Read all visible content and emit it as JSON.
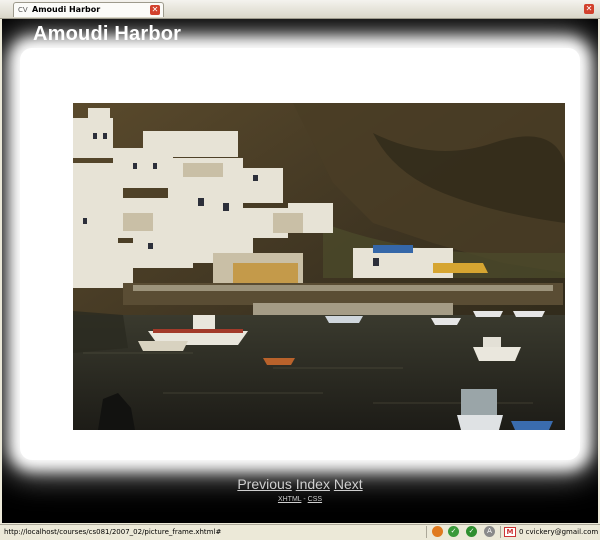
{
  "browser": {
    "tab": {
      "favicon_text": "CV",
      "title": "Amoudi Harbor"
    },
    "status_url": "http://localhost/courses/cs081/2007_02/picture_frame.xhtml#",
    "gmail": {
      "icon_letter": "M",
      "text": "0 cvickery@gmail.com"
    },
    "status_icons": [
      "firefox-icon",
      "validator-ok-icon",
      "check-icon",
      "adblock-icon",
      "extension-icon"
    ]
  },
  "page": {
    "title": "Amoudi Harbor",
    "photo_alt": "Amoudi Harbor",
    "nav": {
      "previous": "Previous",
      "index": "Index",
      "next": "Next"
    },
    "validators": {
      "xhtml": "XHTML",
      "separator": "-",
      "css": "CSS"
    }
  },
  "colors": {
    "page_bg": "#000000",
    "frame": "#ffffff",
    "link": "#cfcfcf",
    "chrome": "#ece9d8"
  }
}
